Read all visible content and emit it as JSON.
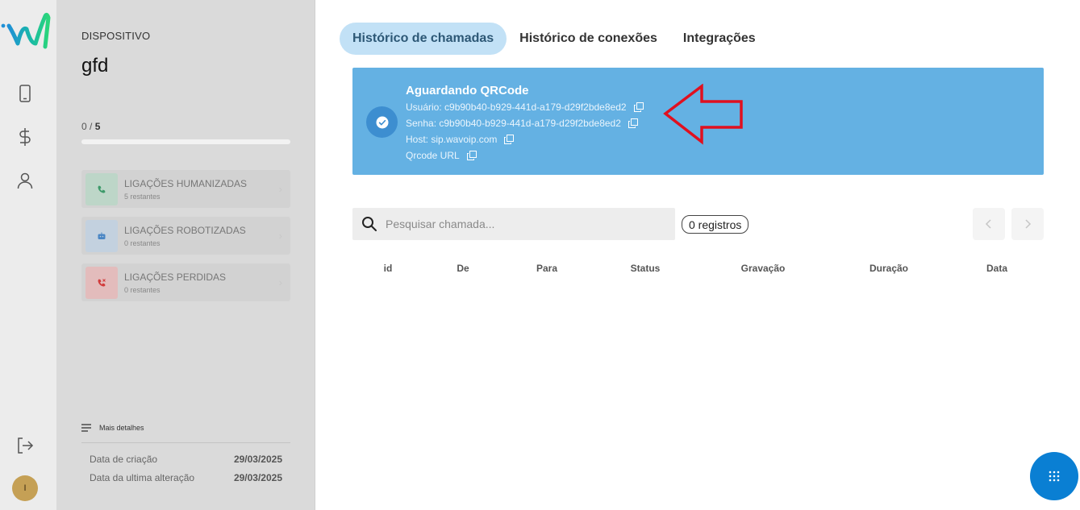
{
  "rail": {
    "icons": [
      "wavoip-logo",
      "phone-icon",
      "dollar-icon",
      "user-icon",
      "logout-icon"
    ],
    "avatar_letter": "I"
  },
  "device": {
    "label": "DISPOSITIVO",
    "name": "gfd",
    "counter_used": "0",
    "counter_sep": " / ",
    "counter_total": "5",
    "progress_fraction": 0,
    "calls": [
      {
        "title": "LIGAÇÕES HUMANIZADAS",
        "sub": "5 restantes",
        "icon": "phone-call-icon",
        "icon_bg": "#bdd6c8",
        "icon_color": "#3d9a6a"
      },
      {
        "title": "LIGAÇÕES ROBOTIZADAS",
        "sub": "0 restantes",
        "icon": "robot-icon",
        "icon_bg": "#c3d1df",
        "icon_color": "#4a86c4"
      },
      {
        "title": "LIGAÇÕES PERDIDAS",
        "sub": "0 restantes",
        "icon": "missed-call-icon",
        "icon_bg": "#e3bcbc",
        "icon_color": "#d23b3b"
      }
    ],
    "more_details": "Mais detalhes",
    "created_label": "Data de criação",
    "created_value": "29/03/2025",
    "updated_label": "Data da ultima alteração",
    "updated_value": "29/03/2025"
  },
  "tabs": [
    {
      "label": "Histórico de chamadas",
      "active": true
    },
    {
      "label": "Histórico de conexões",
      "active": false
    },
    {
      "label": "Integrações",
      "active": false
    }
  ],
  "banner": {
    "title": "Aguardando QRCode",
    "user": "Usuário: c9b90b40-b929-441d-a179-d29f2bde8ed2",
    "password": "Senha: c9b90b40-b929-441d-a179-d29f2bde8ed2",
    "host": "Host: sip.wavoip.com",
    "qrcode": "Qrcode URL"
  },
  "search": {
    "placeholder": "Pesquisar chamada...",
    "count_badge": "0 registros"
  },
  "table": {
    "columns": [
      "id",
      "De",
      "Para",
      "Status",
      "Gravação",
      "Duração",
      "Data"
    ]
  },
  "colors": {
    "accent": "#0a7fd3",
    "banner": "#64b1e3",
    "tab_active_bg": "#c2e1f6",
    "arrow": "#e0101f"
  }
}
